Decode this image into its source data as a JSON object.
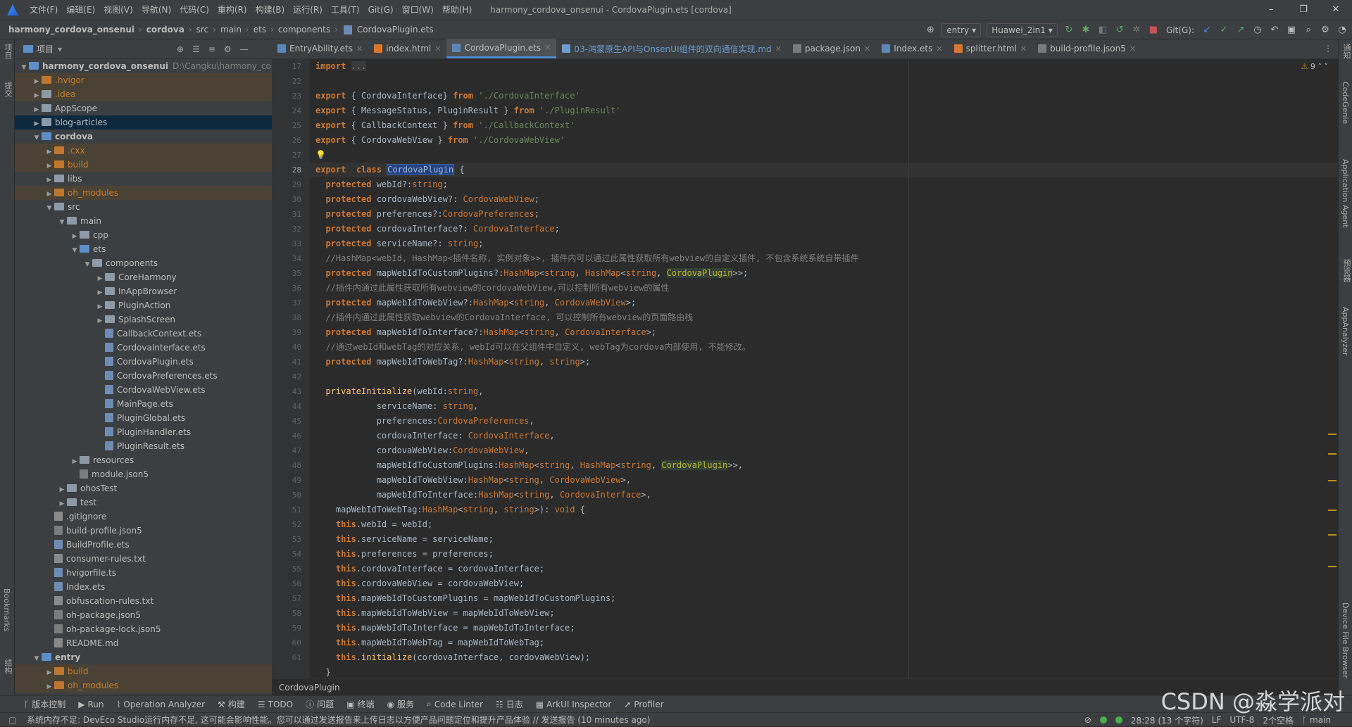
{
  "titlebar": {
    "menus": [
      "文件(F)",
      "编辑(E)",
      "视图(V)",
      "导航(N)",
      "代码(C)",
      "重构(R)",
      "构建(B)",
      "运行(R)",
      "工具(T)",
      "Git(G)",
      "窗口(W)",
      "帮助(H)"
    ],
    "window_title": "harmony_cordova_onsenui - CordovaPlugin.ets [cordova]",
    "minimize": "–",
    "maximize": "❐",
    "close": "✕"
  },
  "navbar": {
    "crumbs": [
      "harmony_cordova_onsenui",
      "cordova",
      "src",
      "main",
      "ets",
      "components",
      "CordovaPlugin.ets"
    ],
    "run_config": "entry",
    "device": "Huawei_2in1",
    "git_label": "Git(G):"
  },
  "project_panel": {
    "title": "项目",
    "rows": [
      {
        "text": "harmony_cordova_onsenui",
        "hint": "D:\\Cangku\\harmony_cord"
      },
      {
        "text": ".hvigor"
      },
      {
        "text": ".idea"
      },
      {
        "text": "AppScope"
      },
      {
        "text": "blog-articles"
      },
      {
        "text": "cordova"
      },
      {
        "text": ".cxx"
      },
      {
        "text": "build"
      },
      {
        "text": "libs"
      },
      {
        "text": "oh_modules"
      },
      {
        "text": "src"
      },
      {
        "text": "main"
      },
      {
        "text": "cpp"
      },
      {
        "text": "ets"
      },
      {
        "text": "components"
      },
      {
        "text": "CoreHarmony"
      },
      {
        "text": "InAppBrowser"
      },
      {
        "text": "PluginAction"
      },
      {
        "text": "SplashScreen"
      },
      {
        "text": "CallbackContext.ets"
      },
      {
        "text": "CordovaInterface.ets"
      },
      {
        "text": "CordovaPlugin.ets"
      },
      {
        "text": "CordovaPreferences.ets"
      },
      {
        "text": "CordovaWebView.ets"
      },
      {
        "text": "MainPage.ets"
      },
      {
        "text": "PluginGlobal.ets"
      },
      {
        "text": "PluginHandler.ets"
      },
      {
        "text": "PluginResult.ets"
      },
      {
        "text": "resources"
      },
      {
        "text": "module.json5"
      },
      {
        "text": "ohosTest"
      },
      {
        "text": "test"
      },
      {
        "text": ".gitignore"
      },
      {
        "text": "build-profile.json5"
      },
      {
        "text": "BuildProfile.ets"
      },
      {
        "text": "consumer-rules.txt"
      },
      {
        "text": "hvigorfile.ts"
      },
      {
        "text": "Index.ets"
      },
      {
        "text": "obfuscation-rules.txt"
      },
      {
        "text": "oh-package.json5"
      },
      {
        "text": "oh-package-lock.json5"
      },
      {
        "text": "README.md"
      },
      {
        "text": "entry"
      },
      {
        "text": "build"
      },
      {
        "text": "oh_modules"
      }
    ]
  },
  "tabs": [
    "EntryAbility.ets",
    "index.html",
    "CordovaPlugin.ets",
    "03-鸿蒙原生API与OnsenUI组件的双向通信实现.md",
    "package.json",
    "Index.ets",
    "splitter.html",
    "build-profile.json5"
  ],
  "editor": {
    "warning_count": "9",
    "line_numbers": [
      "17",
      "22",
      "23",
      "24",
      "25",
      "26",
      "27",
      "28",
      "29",
      "30",
      "31",
      "32",
      "33",
      "34",
      "35",
      "36",
      "37",
      "38",
      "39",
      "40",
      "41",
      "42",
      "43",
      "44",
      "45",
      "46",
      "47",
      "48",
      "49",
      "50",
      "51",
      "52",
      "53",
      "54",
      "55",
      "56",
      "57",
      "58",
      "59",
      "60",
      "61"
    ],
    "comments": [
      "//HashMap<webId, HashMap<插件名称, 实例对象>>, 插件内可以通过此属性获取所有webview的自定义插件, 不包含系统系统自带插件",
      "//插件内通过此属性获取所有webview的cordovaWebView,可以控制所有webview的属性",
      "//插件内通过此属性获取webview的CordovaInterface, 可以控制所有webview的页面路由栈",
      "//通过webId和webTag的对应关系, webId可以在父组件中自定义, webTag为cordova内部使用, 不能修改。"
    ]
  },
  "editor_crumb": "CordovaPlugin",
  "toolwindows": [
    "版本控制",
    "Run",
    "Operation Analyzer",
    "构建",
    "TODO",
    "问题",
    "终端",
    "服务",
    "Code Linter",
    "日志",
    "ArkUI Inspector",
    "Profiler"
  ],
  "status": {
    "message": "系统内存不足: DevEco Studio运行内存不足, 这可能会影响性能。您可以通过发送报告来上传日志以方便产品问题定位和提升产品体验 // 发送报告 (10 minutes ago)",
    "position": "28:28 (13 个字符)",
    "line_sep": "LF",
    "encoding": "UTF-8",
    "indent": "2个空格",
    "branch": "main"
  },
  "right_stripe": [
    "通知",
    "CodeGenie",
    "Application Agent",
    "预览器",
    "AppAnalyzer",
    "Device File Browser"
  ],
  "left_stripe": [
    "项目",
    "提交",
    "Bookmarks",
    "结构"
  ],
  "watermark": "CSDN @淼学派对"
}
